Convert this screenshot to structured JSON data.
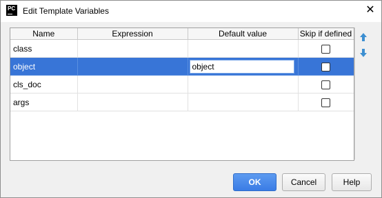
{
  "window": {
    "title": "Edit Template Variables",
    "app_icon_text": "PC",
    "close_glyph": "✕"
  },
  "table": {
    "columns": [
      "Name",
      "Expression",
      "Default value",
      "Skip if defined"
    ],
    "rows": [
      {
        "name": "class",
        "expression": "",
        "default_value": "",
        "skip_if_defined": false
      },
      {
        "name": "object",
        "expression": "",
        "default_value": "object",
        "skip_if_defined": false,
        "selected": true,
        "editing": true
      },
      {
        "name": "cls_doc",
        "expression": "",
        "default_value": "",
        "skip_if_defined": false
      },
      {
        "name": "args",
        "expression": "",
        "default_value": "",
        "skip_if_defined": false
      }
    ]
  },
  "sidebar": {
    "move_up_icon": "arrow-up-icon",
    "move_down_icon": "arrow-down-icon"
  },
  "buttons": {
    "ok": "OK",
    "cancel": "Cancel",
    "help": "Help"
  },
  "colors": {
    "selection": "#3875d7",
    "ok_button": "#3a7ce5",
    "arrow": "#3d8fd1"
  }
}
